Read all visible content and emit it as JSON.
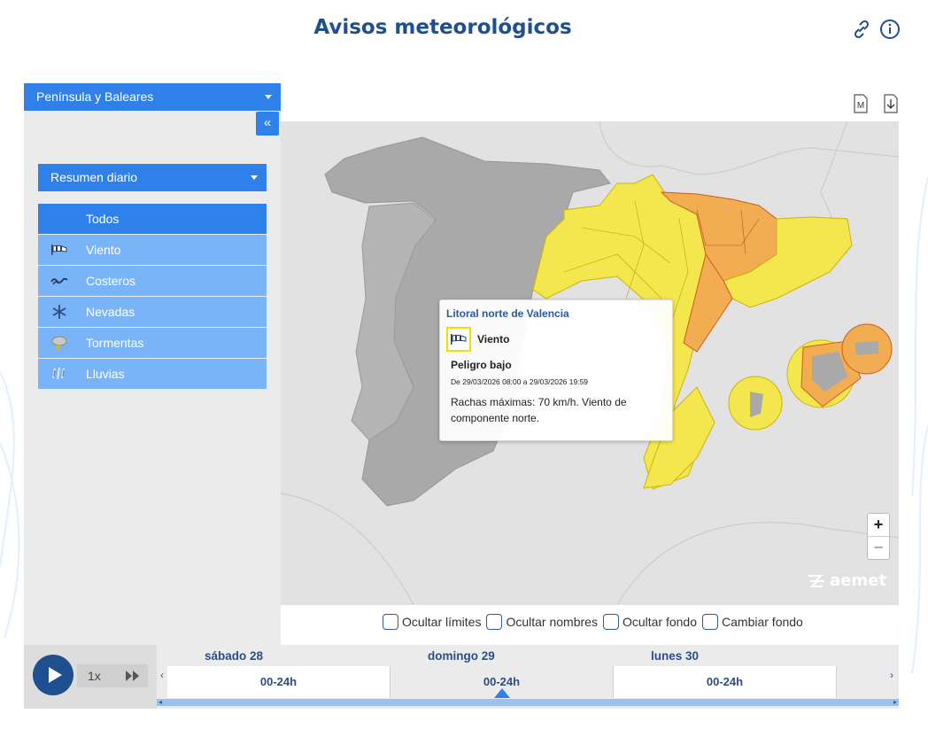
{
  "header": {
    "title": "Avisos meteorológicos",
    "link_icon": "link-icon",
    "info_icon": "info-icon"
  },
  "sidebar": {
    "region_select": "Península y Baleares",
    "collapse_label": "«",
    "summary_select": "Resumen diario",
    "filters": [
      {
        "label": "Todos",
        "icon": "",
        "active": true
      },
      {
        "label": "Viento",
        "icon": "wind-icon",
        "active": false
      },
      {
        "label": "Costeros",
        "icon": "waves-icon",
        "active": false
      },
      {
        "label": "Nevadas",
        "icon": "snowflake-icon",
        "active": false
      },
      {
        "label": "Tormentas",
        "icon": "storm-icon",
        "active": false
      },
      {
        "label": "Lluvias",
        "icon": "rain-icon",
        "active": false
      }
    ]
  },
  "map": {
    "toolbar": {
      "m_label": "M",
      "download_icon": "download-icon"
    },
    "popup": {
      "title": "Litoral norte de Valencia",
      "type": "Viento",
      "level": "Peligro bajo",
      "date": "De 29/03/2026 08:00 a 29/03/2026 19:59",
      "description": "Rachas máximas: 70 km/h. Viento de componente norte."
    },
    "zoom_in": "+",
    "zoom_out": "−",
    "logo": "aemet",
    "colors": {
      "yellow": "#f4e64f",
      "orange": "#f2ad53",
      "grey": "#a8a8a8"
    }
  },
  "options": [
    {
      "label": "Ocultar límites"
    },
    {
      "label": "Ocultar nombres"
    },
    {
      "label": "Ocultar fondo"
    },
    {
      "label": "Cambiar fondo"
    }
  ],
  "timeline": {
    "speed": "1x",
    "days": [
      {
        "name": "sábado 28",
        "slot": "00-24h",
        "selected": false
      },
      {
        "name": "domingo 29",
        "slot": "00-24h",
        "selected": true
      },
      {
        "name": "lunes 30",
        "slot": "00-24h",
        "selected": false
      }
    ]
  }
}
